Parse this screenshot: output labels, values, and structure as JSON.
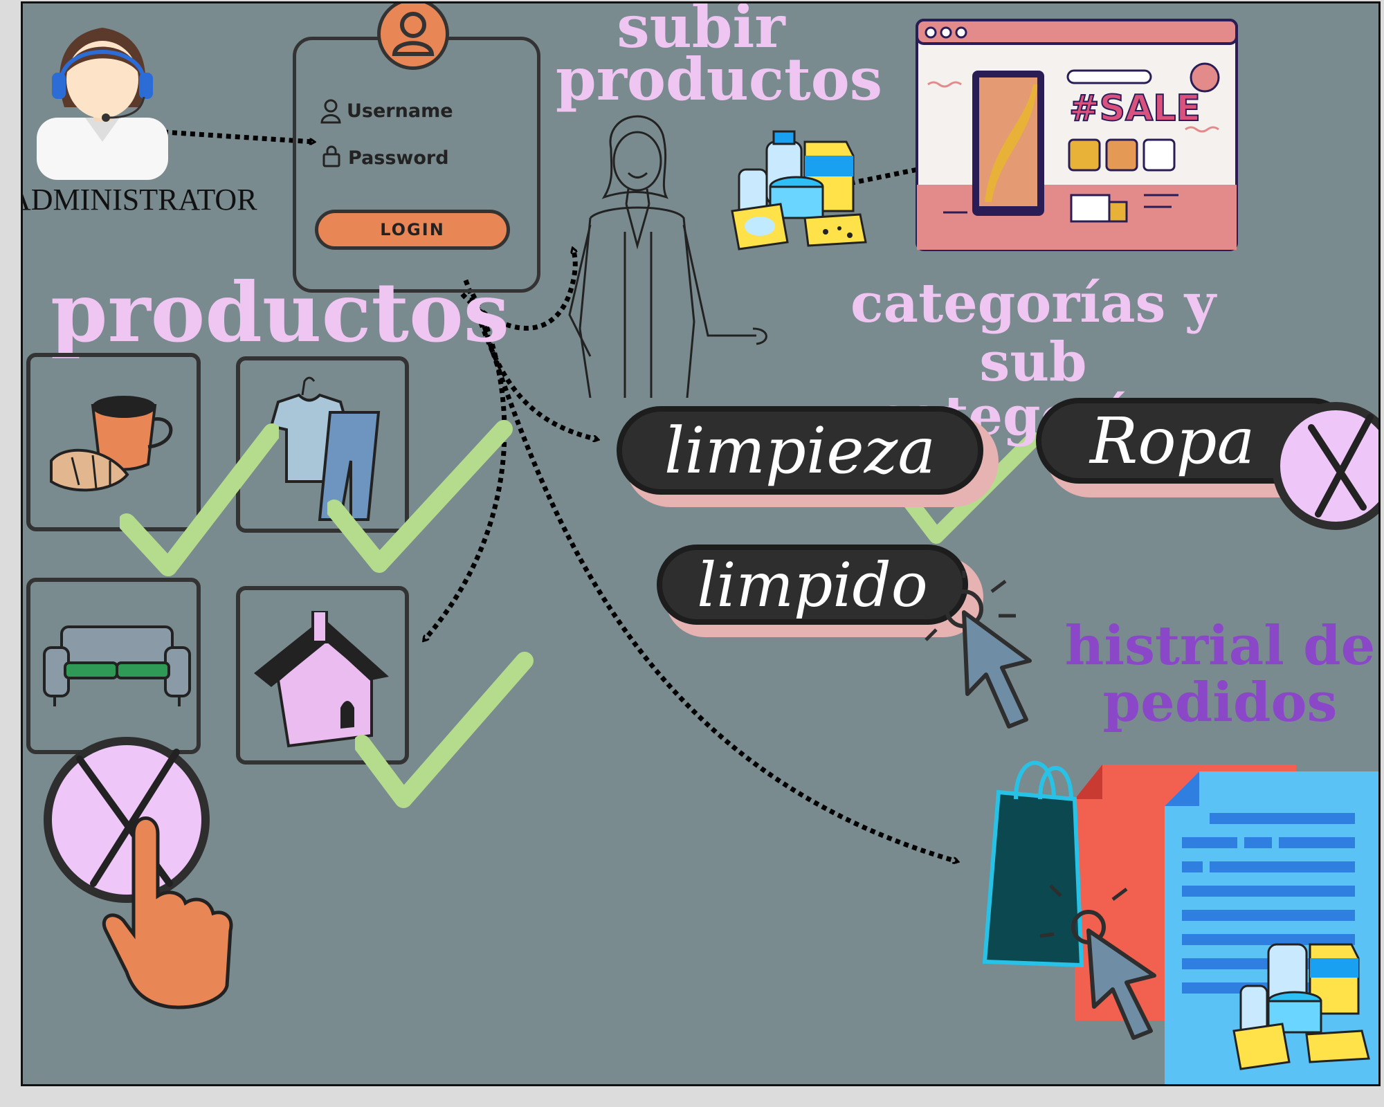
{
  "admin": {
    "label": "ADMINISTRATOR"
  },
  "login": {
    "username_label": "Username",
    "password_label": "Password",
    "button_label": "LOGIN"
  },
  "sections": {
    "upload_title_line1": "subir",
    "upload_title_line2": "productos",
    "products_title": "productos",
    "categories_title_line1": "categorías y",
    "categories_title_line2": "sub categorías",
    "history_title_line1": "histrial de",
    "history_title_line2": "pedidos"
  },
  "sale_window": {
    "tag": "#SALE"
  },
  "categories": {
    "pill1": "limpieza",
    "pill2": "Ropa",
    "pill3": "limpido"
  },
  "colors": {
    "background": "#7a8b8f",
    "title_pink": "#efc6f2",
    "title_purple": "#8a48c8",
    "check_green": "#b5dc8c",
    "accent_orange": "#e98655",
    "pill_pink": "#e6b2b2"
  },
  "icons": [
    "admin-avatar-icon",
    "user-icon",
    "lock-icon",
    "woman-illustration",
    "groceries-icon",
    "sale-window-icon",
    "coffee-croissant-icon",
    "clothes-icon",
    "sofa-icon",
    "house-icon",
    "check-icon",
    "cross-icon",
    "pointing-hand-icon",
    "cursor-icon",
    "shopping-bag-icon",
    "document-icon"
  ]
}
